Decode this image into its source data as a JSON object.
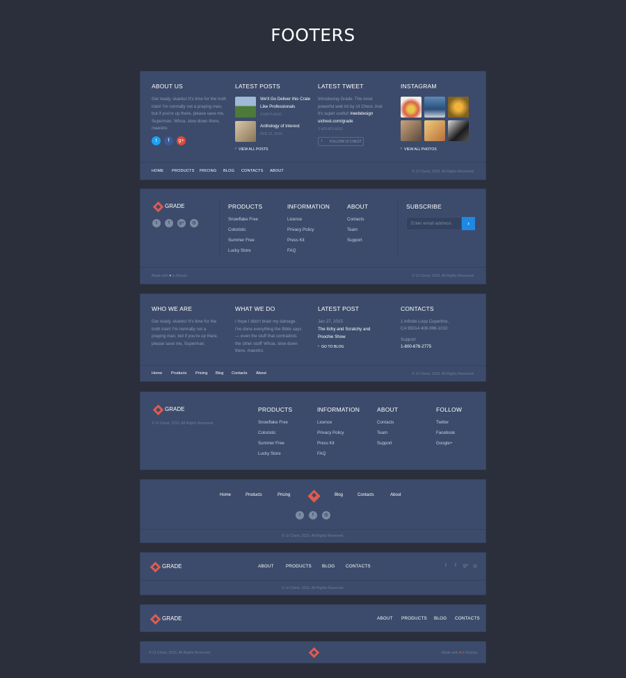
{
  "page_title": "FOOTERS",
  "f1": {
    "about_h": "ABOUT US",
    "about_text": "Get ready, skanks! It's time for the truth train! I'm normally not a praying man, but if you're up there, please save me, Superman. Whoa, slow down there, maestro.",
    "posts_h": "LATEST POSTS",
    "post1_title": "We'll Go Deliver this Crate Like Professionals",
    "post1_date": "3 DAYS AGO",
    "post2_title": "Anthology of Interest",
    "post2_date": "FEB 12, 2015",
    "view_posts": "VIEW ALL POSTS",
    "tweet_h": "LATEST TWEET",
    "tweet_text": "Introducing Grade. The most powerful web kit by UI Chest. And it's super useful!",
    "tweet_tag": "#webdesign",
    "tweet_link": "uichest.com/grade",
    "tweet_time": "3 HOURS AGO",
    "follow_btn": "FOLLOW UI CHEST",
    "insta_h": "INSTAGRAM",
    "view_photos": "VIEW ALL PHOTOS",
    "nav": [
      "HOME",
      "PRODUCTS",
      "PRICING",
      "BLOG",
      "CONTACTS",
      "ABOUT"
    ],
    "copyright": "© UI Chest, 2015. All Rights Reserved."
  },
  "f2": {
    "logo": "GRADE",
    "products_h": "PRODUCTS",
    "products": [
      "Snowflake Free",
      "Coloristic",
      "Summer Free",
      "Lucky Store"
    ],
    "info_h": "INFORMATION",
    "info": [
      "Licence",
      "Privacy Policy",
      "Press Kit",
      "FAQ"
    ],
    "about_h": "ABOUT",
    "about": [
      "Contacts",
      "Team",
      "Support"
    ],
    "subscribe_h": "SUBSCRIBE",
    "email_placeholder": "Enter email address",
    "made_with": "Made with",
    "in_russia": "in Russia",
    "copyright": "© UI Chest, 2015. All Rights Reserved."
  },
  "f3": {
    "who_h": "WHO WE ARE",
    "who_text": "Get ready, skanks! It's time for the truth train! I'm normally not a praying man, but if you're up there, please save me, Superman.",
    "what_h": "WHAT WE DO",
    "what_text": "I hope I didn't brain my damage. I've done everything the Bible says — even the stuff that contradicts the other stuff! Whoa, slow down there, maestro.",
    "post_h": "LATEST POST",
    "post_date": "Jan 27, 2015",
    "post_title": "The Itchy and Scratchy and Poochie Show",
    "go_blog": "GO TO BLOG",
    "contacts_h": "CONTACTS",
    "address1": "1 Infinite Loop Cupertino,",
    "address2": "CA 95014 408-996-1010",
    "support_label": "Support",
    "support_phone": "1-800-676-2775",
    "nav": [
      "Home",
      "Products",
      "Pricing",
      "Blog",
      "Contacts",
      "About"
    ],
    "copyright": "© UI Chest, 2015. All Rights Reserved."
  },
  "f4": {
    "logo": "GRADE",
    "copyright": "© UI Chest, 2015. All Rights Reserved.",
    "products_h": "PRODUCTS",
    "products": [
      "Snowflake Free",
      "Coloristic",
      "Summer Free",
      "Lucky Store"
    ],
    "info_h": "INFORMATION",
    "info": [
      "Licence",
      "Privacy Policy",
      "Press Kit",
      "FAQ"
    ],
    "about_h": "ABOUT",
    "about": [
      "Contacts",
      "Team",
      "Support"
    ],
    "follow_h": "FOLLOW",
    "follow": [
      "Twitter",
      "Facebook",
      "Google+"
    ]
  },
  "f5": {
    "nav_left": [
      "Home",
      "Products",
      "Pricing"
    ],
    "nav_right": [
      "Blog",
      "Contacts",
      "About"
    ],
    "copyright": "© UI Chest, 2015. All Rights Reserved."
  },
  "f6": {
    "logo": "GRADE",
    "nav": [
      "ABOUT",
      "PRODUCTS",
      "BLOG",
      "CONTACTS"
    ],
    "copyright": "© UI Chest, 2015. All Rights Reserved."
  },
  "f7": {
    "logo": "GRADE",
    "nav": [
      "ABOUT",
      "PRODUCTS",
      "BLOG",
      "CONTACTS"
    ]
  },
  "f8": {
    "copyright": "© UI Chest, 2015. All Rights Reserved.",
    "made_with": "Made with",
    "in_russia": "in Russia"
  },
  "colors": {
    "background": "#2a2f3b",
    "card": "#3c4b6b",
    "accent": "#e25a4f",
    "twitter": "#1da1f2",
    "facebook": "#3b5998",
    "google": "#dd4b39",
    "button": "#1e88e5"
  }
}
